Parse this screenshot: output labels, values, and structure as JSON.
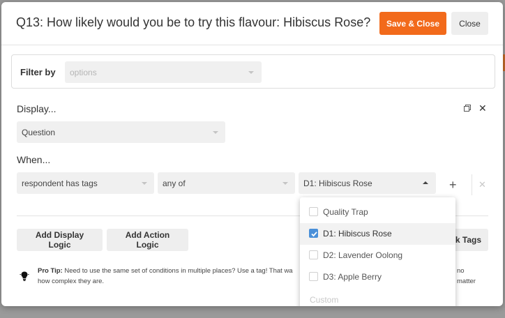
{
  "modal": {
    "title": "Q13: How likely would you be to try this flavour: Hibiscus Rose?",
    "save_label": "Save & Close",
    "close_label": "Close"
  },
  "filter": {
    "label": "Filter by",
    "placeholder": "options"
  },
  "display": {
    "label": "Display...",
    "value": "Question"
  },
  "when": {
    "label": "When...",
    "condition": "respondent has tags",
    "match": "any of",
    "tag_value": "D1: Hibiscus Rose",
    "add_symbol": "+",
    "remove_symbol": "✕"
  },
  "actions": {
    "add_display_logic": "Add Display Logic",
    "add_action_logic": "Add Action Logic",
    "partial_button": "k Tags"
  },
  "pro_tip": {
    "label": "Pro Tip:",
    "text_line1": " Need to use the same set of conditions in multiple places? Use a tag! That wa",
    "text_line1_end": "no matter",
    "text_line2": "how complex they are."
  },
  "dropdown": {
    "items": [
      {
        "label": "Quality Trap",
        "checked": false
      },
      {
        "label": "D1: Hibiscus Rose",
        "checked": true
      },
      {
        "label": "D2: Lavender Oolong",
        "checked": false
      },
      {
        "label": "D3: Apple Berry",
        "checked": false
      }
    ],
    "custom_placeholder": "Custom"
  },
  "colors": {
    "accent": "#f26a1b",
    "checkbox": "#4a90d9"
  },
  "icons": {
    "copy": "copy-icon",
    "close": "close-icon",
    "bulb": "lightbulb-icon"
  }
}
